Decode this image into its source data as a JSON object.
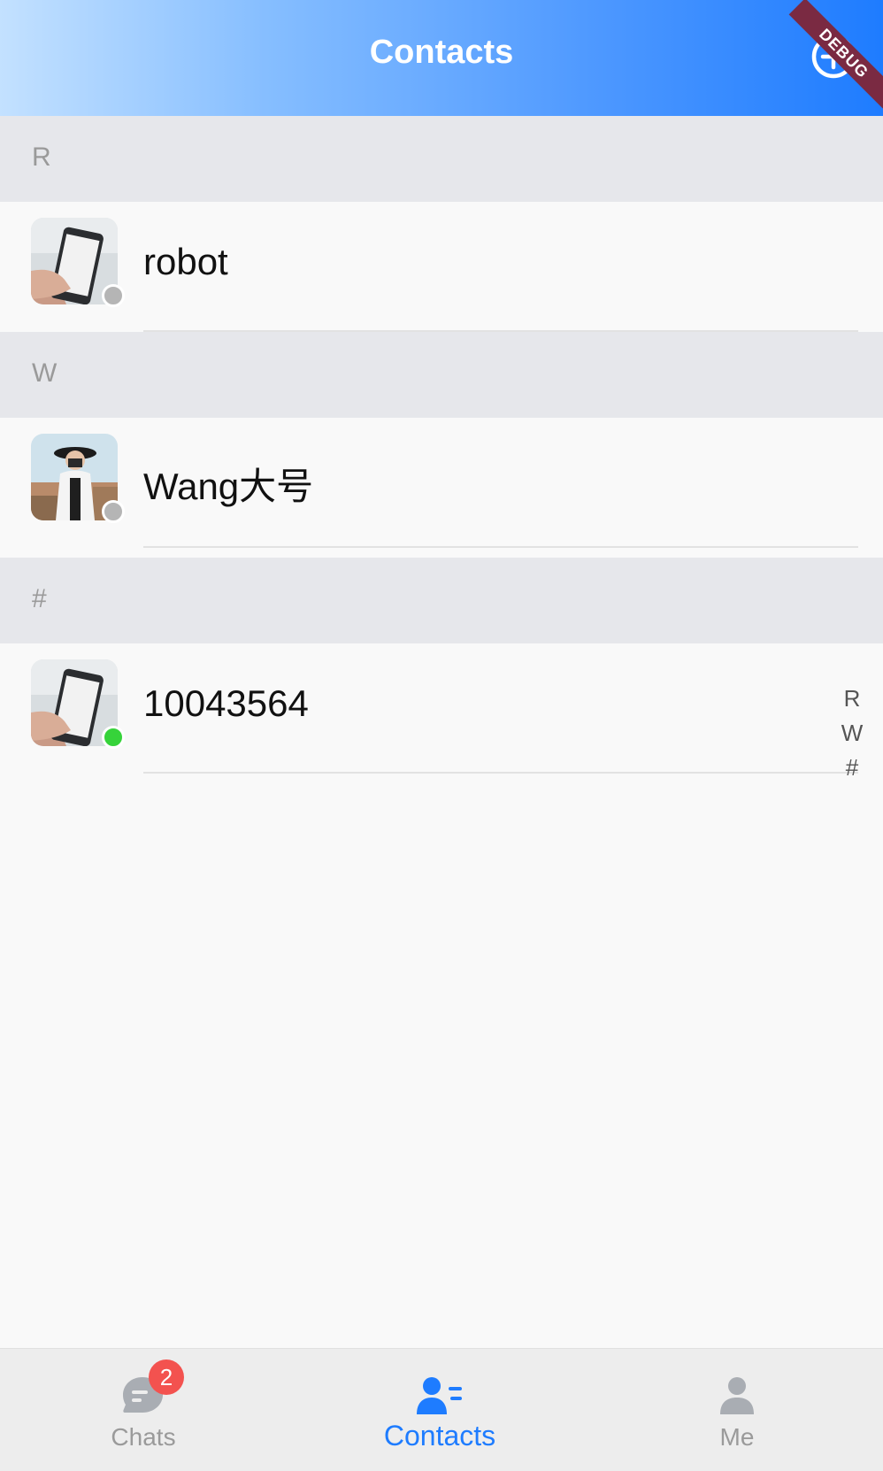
{
  "header": {
    "title": "Contacts",
    "debug_banner": "DEBUG",
    "add_icon": "plus-circle-icon"
  },
  "sections": [
    {
      "letter": "R",
      "contacts": [
        {
          "name": "robot",
          "avatar": "phone-in-hand-photo",
          "status": "offline",
          "status_color": "#b5b5b5"
        }
      ]
    },
    {
      "letter": "W",
      "contacts": [
        {
          "name": "Wang大号",
          "avatar": "woman-with-camera-photo",
          "status": "offline",
          "status_color": "#b5b5b5"
        }
      ]
    },
    {
      "letter": "#",
      "contacts": [
        {
          "name": "10043564",
          "avatar": "phone-in-hand-photo",
          "status": "online",
          "status_color": "#36d33a"
        }
      ]
    }
  ],
  "index_bar": [
    "R",
    "W",
    "#"
  ],
  "bottom_nav": {
    "items": [
      {
        "label": "Chats",
        "icon": "chat-bubble-icon",
        "badge": "2",
        "active": false
      },
      {
        "label": "Contacts",
        "icon": "contacts-icon",
        "active": true
      },
      {
        "label": "Me",
        "icon": "person-icon",
        "active": false
      }
    ]
  },
  "colors": {
    "accent": "#1e7cff",
    "inactive": "#9a9a9a",
    "badge": "#f3524f",
    "section_bg": "#e6e7eb"
  }
}
